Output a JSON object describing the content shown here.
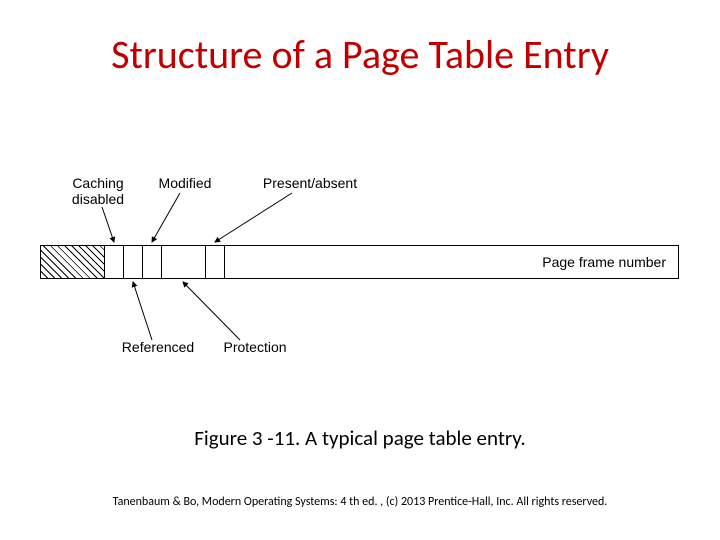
{
  "title": "Structure of a Page Table Entry",
  "caption": "Figure 3 -11. A typical page table entry.",
  "footer": "Tanenbaum & Bo, Modern  Operating Systems: 4 th ed. , (c) 2013 Prentice-Hall, Inc. All rights reserved.",
  "diagram": {
    "fields": {
      "hatched": "",
      "caching_disabled": "Caching\ndisabled",
      "referenced": "Referenced",
      "modified": "Modified",
      "protection": "Protection",
      "present_absent": "Present/absent",
      "page_frame_number": "Page frame number"
    }
  }
}
